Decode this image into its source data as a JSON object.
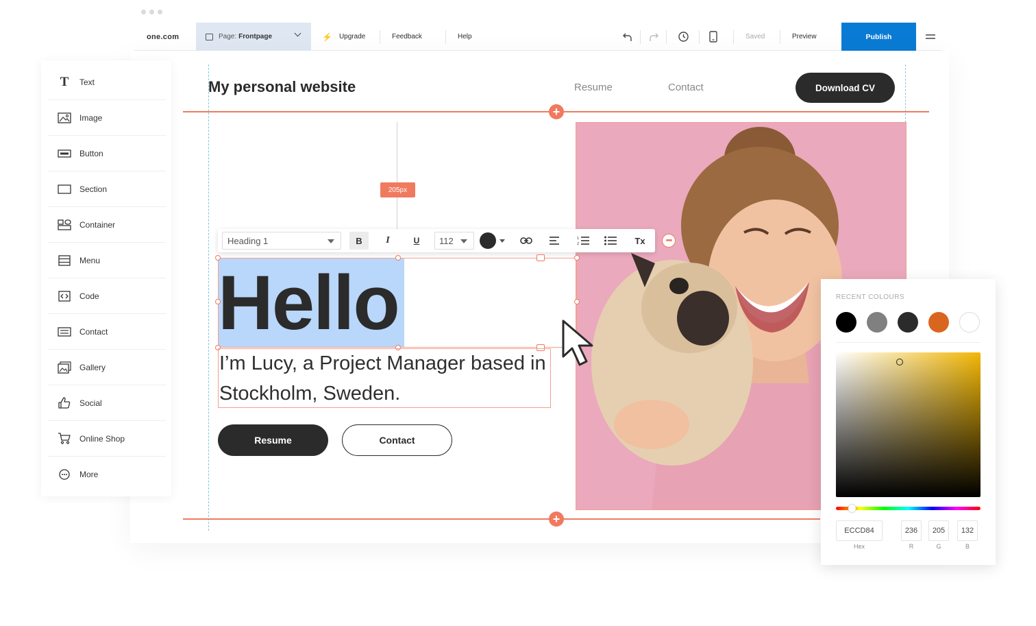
{
  "topbar": {
    "brand": "one.com",
    "page_label": "Page:",
    "page_value": "Frontpage",
    "upgrade": "Upgrade",
    "feedback": "Feedback",
    "help": "Help",
    "saved": "Saved",
    "preview": "Preview",
    "publish": "Publish"
  },
  "sidebar": {
    "items": [
      {
        "label": "Text",
        "icon": "text-icon"
      },
      {
        "label": "Image",
        "icon": "image-icon"
      },
      {
        "label": "Button",
        "icon": "button-icon"
      },
      {
        "label": "Section",
        "icon": "section-icon"
      },
      {
        "label": "Container",
        "icon": "container-icon"
      },
      {
        "label": "Menu",
        "icon": "menu-icon"
      },
      {
        "label": "Code",
        "icon": "code-icon"
      },
      {
        "label": "Contact",
        "icon": "contact-icon"
      },
      {
        "label": "Gallery",
        "icon": "gallery-icon"
      },
      {
        "label": "Social",
        "icon": "thumbs-up-icon"
      },
      {
        "label": "Online Shop",
        "icon": "cart-icon"
      },
      {
        "label": "More",
        "icon": "more-icon"
      }
    ]
  },
  "site": {
    "title": "My personal website",
    "nav": [
      "Resume",
      "Contact"
    ],
    "download_cv": "Download CV",
    "spacing_badge": "205px",
    "hello": "Hello",
    "subtitle": "I’m Lucy, a Project Manager based in Stockholm, Sweden.",
    "resume_button": "Resume",
    "contact_button": "Contact"
  },
  "text_toolbar": {
    "style": "Heading 1",
    "bold": "B",
    "italic": "I",
    "underline": "U",
    "font_size": "112",
    "clear_format": "Tx",
    "text_color": "#2b2b2b"
  },
  "color_picker": {
    "title": "RECENT COLOURS",
    "recent": [
      "#000000",
      "#808080",
      "#2b2b2b",
      "#d9661f",
      "#ffffff"
    ],
    "hex": "ECCD84",
    "r": "236",
    "g": "205",
    "b": "132",
    "hex_label": "Hex",
    "r_label": "R",
    "g_label": "G",
    "b_label": "B"
  },
  "colors": {
    "accent": "#f07a5f",
    "publish": "#0a7bd4",
    "selection": "#b9d6fb",
    "hero_bg": "#eaa8bd"
  }
}
